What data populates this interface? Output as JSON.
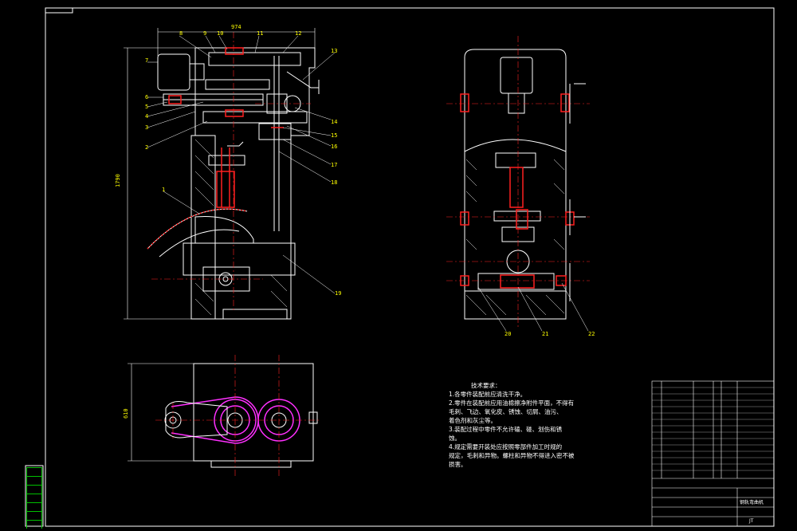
{
  "colors": {
    "line": "#ffffff",
    "red": "#ff2020",
    "green": "#00e000",
    "magenta": "#ff30ff",
    "yellow": "#ffff00",
    "cyan": "#00ffff"
  },
  "dims": {
    "width_top": "974",
    "height_left": "1790",
    "width_bottom": "610"
  },
  "part_labels": [
    "1",
    "2",
    "3",
    "4",
    "5",
    "6",
    "7",
    "8",
    "9",
    "10",
    "11",
    "12",
    "13",
    "14",
    "15",
    "16",
    "17",
    "18",
    "19",
    "20",
    "21",
    "22"
  ],
  "notes": {
    "title": "技术要求：",
    "lines": [
      "1.各零件装配前应清洗干净。",
      "2.零件在装配前应用油棉擦净附件平面，不得有",
      "  毛刺、飞边、氧化皮、锈蚀、切屑、油污、",
      "  着色剂和灰尘等。",
      "3.装配过程中零件不允许磕、碰、划伤和锈",
      "  蚀。",
      "4.规定需要开装处应按照零部件加工时规的",
      "  规定，毛刺和异物。螺柱和异物不得进入密不被",
      "  损害。"
    ]
  },
  "title_block": {
    "name": "钢轨弯曲机",
    "drawing_no": "JT"
  },
  "sidebar_cells": [
    "",
    "",
    "",
    "",
    "",
    "",
    "",
    ""
  ]
}
